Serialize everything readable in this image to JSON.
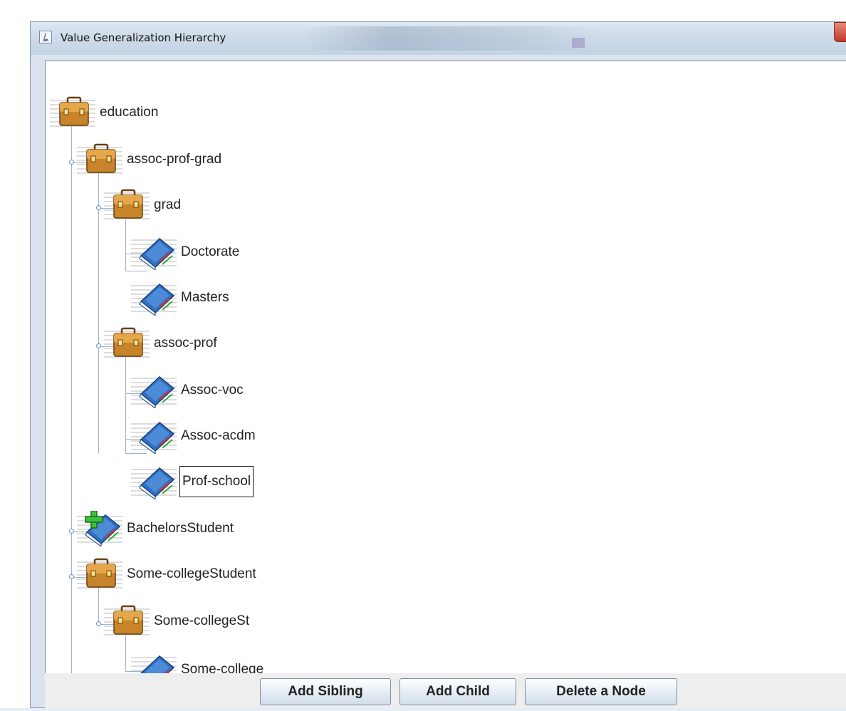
{
  "window": {
    "title": "Value Generalization Hierarchy"
  },
  "tree": {
    "nodes": [
      {
        "label": "education",
        "icon": "briefcase-icon",
        "depth": 0
      },
      {
        "label": "assoc-prof-grad",
        "icon": "briefcase-icon",
        "depth": 1
      },
      {
        "label": "grad",
        "icon": "briefcase-icon",
        "depth": 2
      },
      {
        "label": "Doctorate",
        "icon": "book-icon",
        "depth": 3
      },
      {
        "label": "Masters",
        "icon": "book-icon",
        "depth": 3
      },
      {
        "label": "assoc-prof",
        "icon": "briefcase-icon",
        "depth": 2
      },
      {
        "label": "Assoc-voc",
        "icon": "book-icon",
        "depth": 3
      },
      {
        "label": "Assoc-acdm",
        "icon": "book-icon",
        "depth": 3
      },
      {
        "label": "Prof-school",
        "icon": "book-icon",
        "depth": 3,
        "selected": true
      },
      {
        "label": "BachelorsStudent",
        "icon": "book-add-icon",
        "depth": 1
      },
      {
        "label": "Some-collegeStudent",
        "icon": "briefcase-icon",
        "depth": 1
      },
      {
        "label": "Some-collegeSt",
        "icon": "briefcase-icon",
        "depth": 2
      },
      {
        "label": "Some-college",
        "icon": "book-icon",
        "depth": 3
      }
    ]
  },
  "buttons": {
    "add_sibling": "Add Sibling",
    "add_child": "Add Child",
    "delete_node": "Delete a Node"
  },
  "colors": {
    "briefcase": "#c8842a",
    "book": "#2f6fc4",
    "tree_line": "#9db3cc"
  }
}
